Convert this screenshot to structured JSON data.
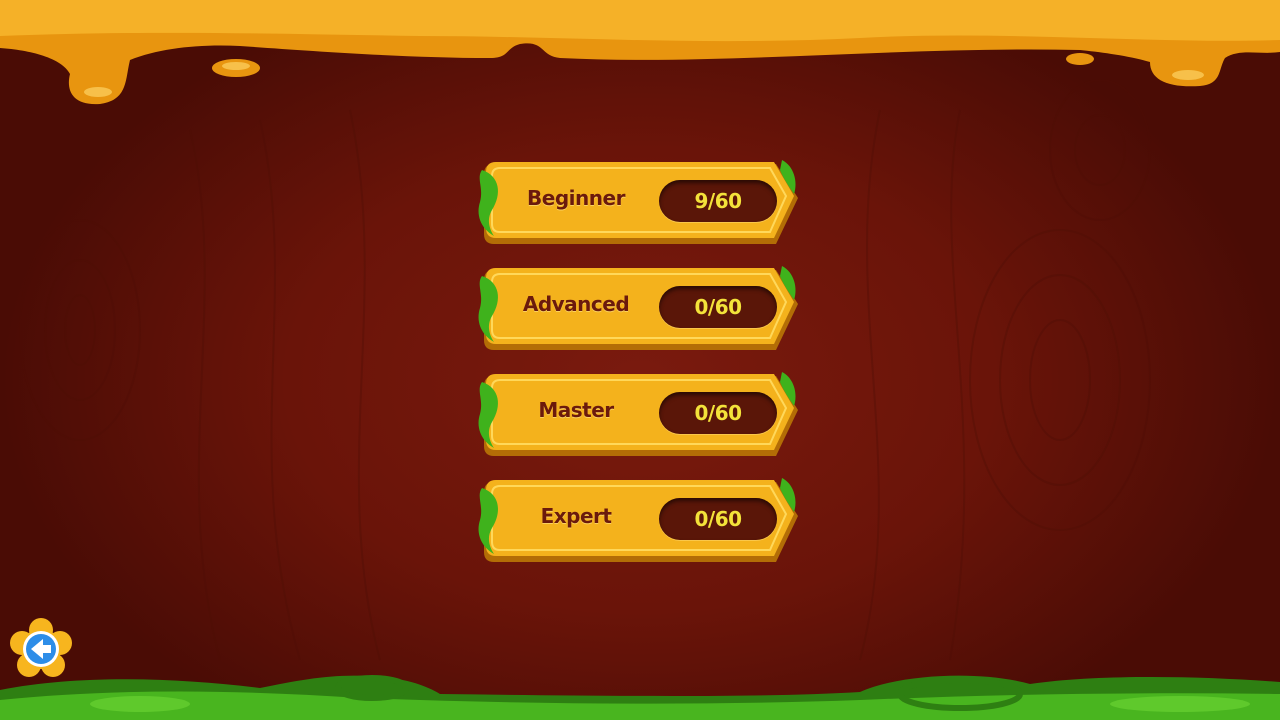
{
  "levels": [
    {
      "id": "beginner",
      "label": "Beginner",
      "score": "9/60"
    },
    {
      "id": "advanced",
      "label": "Advanced",
      "score": "0/60"
    },
    {
      "id": "master",
      "label": "Master",
      "score": "0/60"
    },
    {
      "id": "expert",
      "label": "Expert",
      "score": "0/60"
    }
  ],
  "back_button": {
    "icon": "arrow-left-icon"
  },
  "colors": {
    "background": "#6a1409",
    "honey": "#f0a21a",
    "plate": "#f4b21c",
    "plate_edge": "#b36d06",
    "score_bg": "#5a1608",
    "score_text": "#f3e23a",
    "label_text": "#6b1a0c",
    "leaf": "#3fb21c",
    "grass": "#3e9e1a",
    "back_ring": "#f7b51e",
    "back_core": "#2d8de8"
  }
}
